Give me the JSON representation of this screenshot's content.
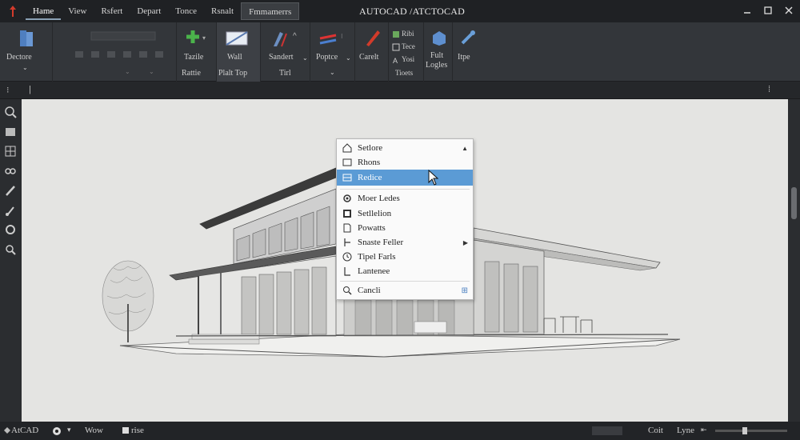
{
  "titlebar": {
    "tabs": [
      "Hame",
      "View",
      "Rsfert",
      "Depart",
      "Tonce",
      "Rsnalt",
      "Fmmamerrs"
    ],
    "app_title": "AUTOCAD /ATCTOCAD"
  },
  "ribbon": {
    "dectore": "Dectore",
    "tazile": "Tazile",
    "wall": "Wall",
    "sandert": "Sandert",
    "poptce": "Poptce",
    "carelt": "Carelt",
    "small_1": "Ribi",
    "small_2": "Tece",
    "small_3": "Yosi",
    "fult": "Fult",
    "logles": "Logles",
    "itpe": "Itpe",
    "rattie": "Rattie",
    "plalt_top": "Plalt Top",
    "tirl": "Tirl",
    "tioets": "Tioets"
  },
  "context_menu": {
    "items": [
      {
        "label": "Setlore"
      },
      {
        "label": "Rhons"
      },
      {
        "label": "Redice"
      },
      {
        "label": "Moer Ledes"
      },
      {
        "label": "Setllelion"
      },
      {
        "label": "Powatts"
      },
      {
        "label": "Snaste Feller"
      },
      {
        "label": "Tipel Farls"
      },
      {
        "label": "Lantenee"
      },
      {
        "label": "Cancli"
      }
    ]
  },
  "statusbar": {
    "app": "AtCAD",
    "view": "Wow",
    "rise": "rise",
    "coit": "Coit",
    "lyne": "Lyne"
  }
}
